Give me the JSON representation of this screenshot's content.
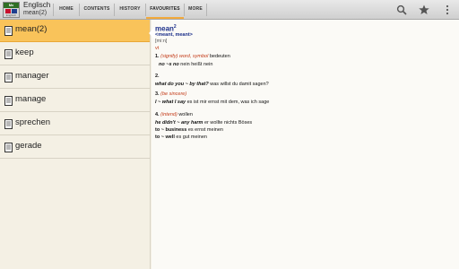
{
  "app": {
    "logo_text": "Mx PONS",
    "logo_subtext": "Englisch",
    "title": "Englisch",
    "subtitle": "mean(2)"
  },
  "tabs": [
    {
      "label": "HOME",
      "active": false
    },
    {
      "label": "CONTENTS",
      "active": false
    },
    {
      "label": "HISTORY",
      "active": false
    },
    {
      "label": "FAVOURITES",
      "active": true
    },
    {
      "label": "MORE",
      "active": false
    }
  ],
  "toolbar_icons": [
    "search-icon",
    "star-icon",
    "overflow-menu-icon"
  ],
  "list": [
    {
      "label": "mean(2)",
      "selected": true
    },
    {
      "label": "keep",
      "selected": false
    },
    {
      "label": "manager",
      "selected": false
    },
    {
      "label": "manage",
      "selected": false
    },
    {
      "label": "sprechen",
      "selected": false
    },
    {
      "label": "gerade",
      "selected": false
    }
  ],
  "entry": {
    "headword": "mean",
    "homograph": "2",
    "forms": "<meant, meant>",
    "pronunciation": "[mi:n]",
    "pos": "vt",
    "senses": [
      {
        "number": "1.",
        "paren": "(signify) word, symbol",
        "translation": "bedeuten",
        "examples": [
          {
            "phrase": "no ~s no",
            "translation": "nein heißt nein"
          }
        ]
      },
      {
        "number": "2.",
        "examples": [
          {
            "phrase": "what do you ~ by that?",
            "translation": "was willst du damit sagen?"
          }
        ]
      },
      {
        "number": "3.",
        "paren": "(be sincere)",
        "examples": [
          {
            "phrase": "I ~ what I say",
            "translation": "es ist mir ernst mit dem, was ich sage"
          }
        ]
      },
      {
        "number": "4.",
        "paren": "(intend)",
        "translation": "wollen",
        "examples": [
          {
            "phrase": "he didn't ~ any harm",
            "translation": "er wollte nichts Böses"
          },
          {
            "phrase": "to ~ business",
            "translation": "es ernst meinen"
          },
          {
            "phrase": "to ~ well",
            "translation": "es gut meinen"
          }
        ]
      }
    ]
  },
  "colors": {
    "selected_row": "#f9c35a",
    "headword": "#1b2f8a",
    "sense": "#c33a17"
  }
}
